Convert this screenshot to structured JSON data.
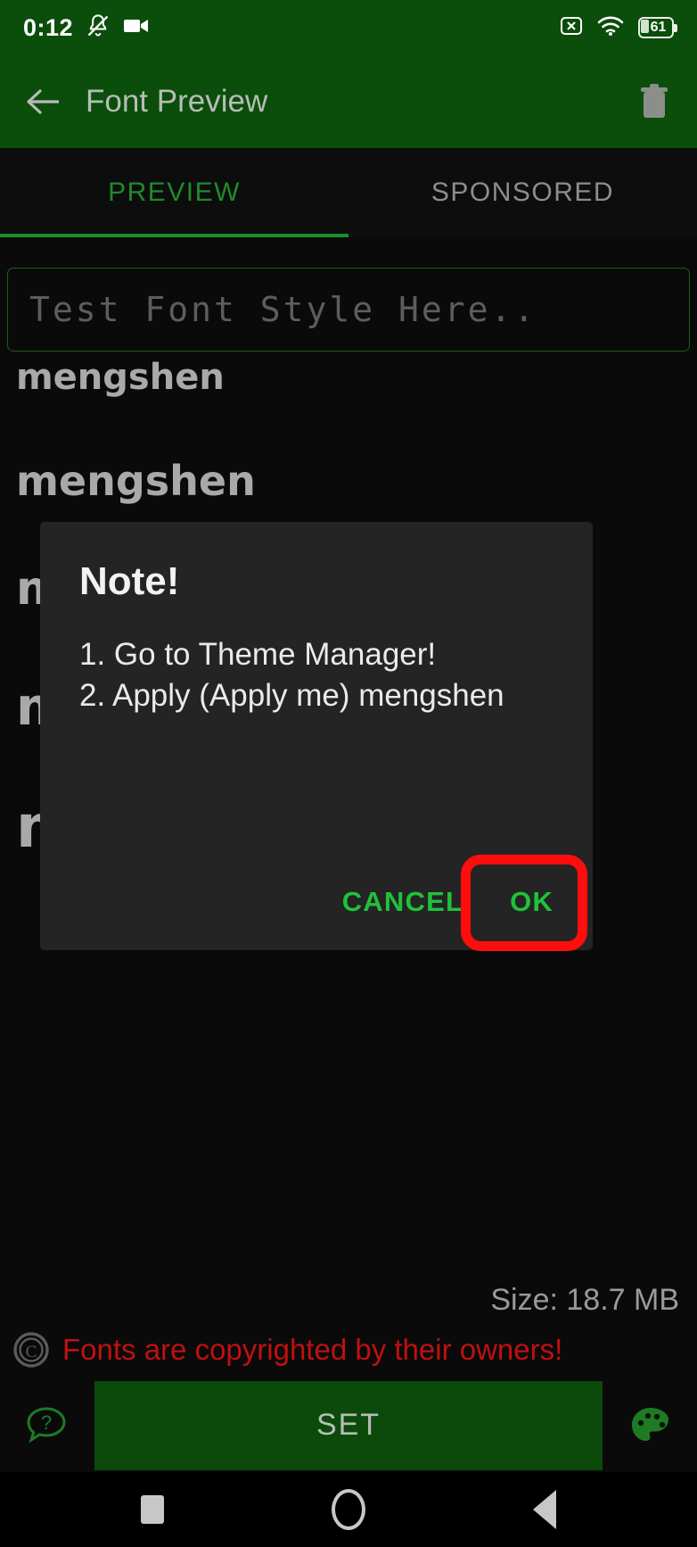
{
  "status_bar": {
    "clock": "0:12",
    "battery_percent": "61",
    "icons": [
      "mute-bell-icon",
      "video-camera-icon",
      "sim-x-icon",
      "wifi-icon",
      "battery-icon"
    ]
  },
  "app_bar": {
    "title": "Font Preview",
    "back_icon": "arrow-left-icon",
    "delete_icon": "trash-icon"
  },
  "tabs": [
    {
      "label": "PREVIEW",
      "active": true
    },
    {
      "label": "SPONSORED",
      "active": false
    }
  ],
  "search": {
    "placeholder": "Test Font Style Here.."
  },
  "preview_rows": [
    {
      "text": "mengshen",
      "size": 40
    },
    {
      "text": "mengshen",
      "size": 46
    },
    {
      "text": "mengshen",
      "size": 52
    },
    {
      "text": "mengshen",
      "size": 58
    },
    {
      "text": "mengshen",
      "size": 66
    }
  ],
  "dialog": {
    "title": "Note!",
    "body": "1. Go to Theme Manager!\n2. Apply (Apply me) mengshen",
    "cancel_label": "CANCEL",
    "ok_label": "OK"
  },
  "footer": {
    "size_text": "Size: 18.7 MB",
    "copyright_text": "Fonts are copyrighted by their owners!",
    "copyright_icon": "copyright-icon"
  },
  "action_bar": {
    "help_icon": "help-bubble-icon",
    "set_label": "SET",
    "palette_icon": "palette-icon"
  },
  "nav_bar": {
    "recents": "recents-square-icon",
    "home": "home-circle-icon",
    "back": "back-triangle-icon"
  },
  "colors": {
    "brand_green": "#0b4d0b",
    "accent_green": "#1fc23a",
    "highlight_red": "#fd0d0d",
    "warning_red": "#c01010",
    "background": "#0a0a0a",
    "dialog_bg": "#242424"
  }
}
